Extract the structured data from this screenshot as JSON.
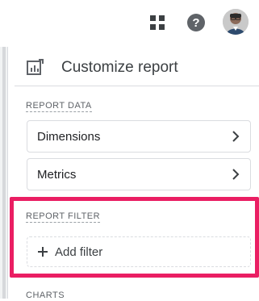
{
  "topbar": {
    "apps_icon": "apps-grid-icon",
    "help_icon": "help-icon",
    "avatar_icon": "user-avatar"
  },
  "panel": {
    "title": "Customize report",
    "title_icon": "report-chart-icon",
    "sections": {
      "report_data": {
        "label": "REPORT DATA",
        "items": [
          {
            "label": "Dimensions",
            "icon": "chevron-right-icon"
          },
          {
            "label": "Metrics",
            "icon": "chevron-right-icon"
          }
        ]
      },
      "report_filter": {
        "label": "REPORT FILTER",
        "add_filter_label": "Add filter",
        "add_icon": "plus-icon",
        "highlight_color": "#ea1e63"
      },
      "charts": {
        "label": "CHARTS"
      }
    }
  }
}
